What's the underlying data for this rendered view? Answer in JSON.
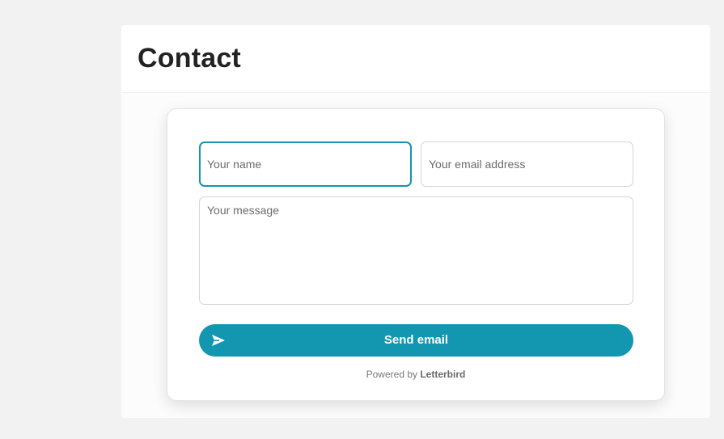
{
  "page": {
    "title": "Contact"
  },
  "form": {
    "name_placeholder": "Your name",
    "email_placeholder": "Your email address",
    "message_placeholder": "Your message",
    "send_label": "Send email",
    "send_icon": "paper-plane-icon",
    "powered_prefix": "Powered by",
    "powered_brand": "Letterbird"
  },
  "colors": {
    "accent": "#1396b0",
    "focus_border": "#1694ad",
    "background": "#f2f2f2"
  }
}
